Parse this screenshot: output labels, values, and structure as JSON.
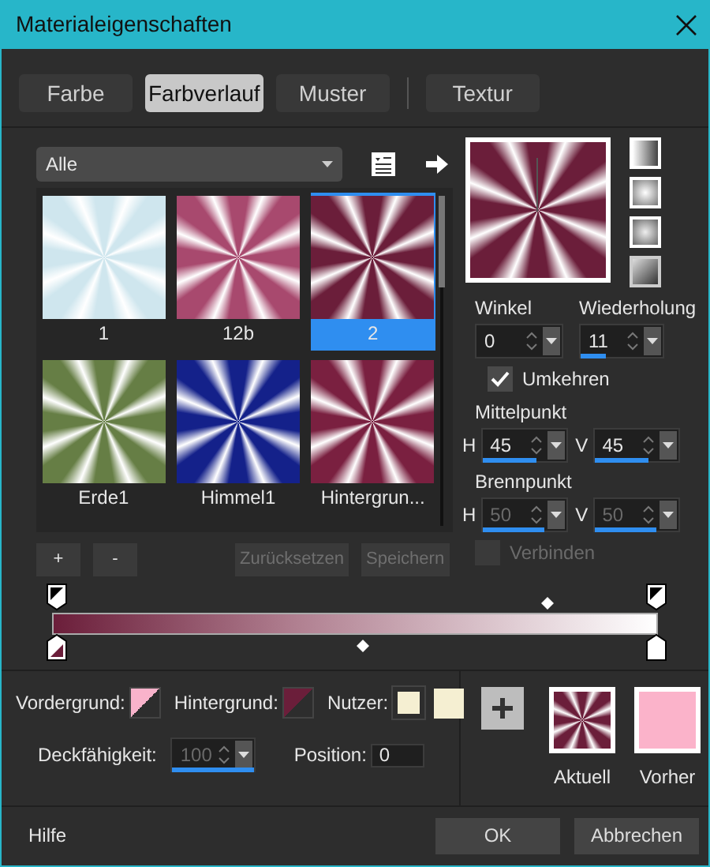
{
  "window": {
    "title": "Materialeigenschaften"
  },
  "tabs": [
    {
      "label": "Farbe",
      "selected": false
    },
    {
      "label": "Farbverlauf",
      "selected": true
    },
    {
      "label": "Muster",
      "selected": false
    },
    {
      "label": "Textur",
      "selected": false
    }
  ],
  "category": {
    "value": "Alle"
  },
  "presets": [
    {
      "label": "1",
      "color": "#cfe6ee",
      "selected": false
    },
    {
      "label": "12b",
      "color": "#a8496e",
      "selected": false
    },
    {
      "label": "2",
      "color": "#6b1e3a",
      "selected": true
    },
    {
      "label": "Erde1",
      "color": "#667e45",
      "selected": false
    },
    {
      "label": "Himmel1",
      "color": "#14218a",
      "selected": false
    },
    {
      "label": "Hintergrun...",
      "color": "#7a2040",
      "selected": false
    }
  ],
  "list_buttons": [
    {
      "label": "+",
      "disabled": false
    },
    {
      "label": "-",
      "disabled": false
    },
    {
      "label": "Zurücksetzen",
      "disabled": true
    },
    {
      "label": "Speichern",
      "disabled": true
    }
  ],
  "angle": {
    "label": "Winkel",
    "value": "0"
  },
  "repeat": {
    "label": "Wiederholung",
    "value": "11",
    "level": 0.3
  },
  "invert": {
    "label": "Umkehren",
    "checked": true,
    "disabled": false
  },
  "center": {
    "label": "Mittelpunkt",
    "fields": [
      {
        "axis": "H",
        "value": "45",
        "level": 0.65,
        "disabled": false
      },
      {
        "axis": "V",
        "value": "45",
        "level": 0.65,
        "disabled": false
      }
    ]
  },
  "focus": {
    "label": "Brennpunkt",
    "fields": [
      {
        "axis": "H",
        "value": "50",
        "level": 0.75,
        "disabled": true
      },
      {
        "axis": "V",
        "value": "50",
        "level": 0.75,
        "disabled": true
      }
    ]
  },
  "link": {
    "label": "Verbinden",
    "checked": false,
    "disabled": true
  },
  "swatches": [
    {
      "label": "Vordergrund:",
      "color": "#f9b3cb",
      "kind": "triangle"
    },
    {
      "label": "Hintergrund:",
      "color": "#6b1e3a",
      "kind": "triangle"
    },
    {
      "label": "Nutzer:",
      "color": "#f5efd2",
      "kind": "double"
    }
  ],
  "opacity": {
    "label": "Deckfähigkeit:",
    "value": "100",
    "level": 1,
    "disabled": true
  },
  "position": {
    "label": "Position:",
    "value": "0"
  },
  "preview": [
    {
      "label": "Aktuell",
      "color": "#6b1e3a",
      "kind": "gradient"
    },
    {
      "label": "Vorher",
      "color": "#fbb3ca",
      "kind": "solid"
    }
  ],
  "footer": {
    "help": "Hilfe",
    "buttons": [
      "OK",
      "Abbrechen"
    ]
  }
}
